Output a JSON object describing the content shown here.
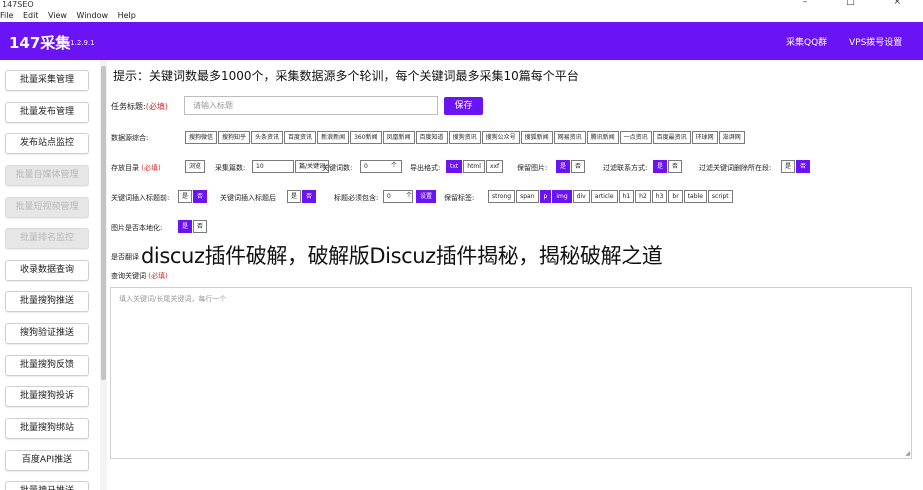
{
  "window": {
    "title": "147SEO",
    "controls": "– □ ×"
  },
  "menu": [
    "File",
    "Edit",
    "View",
    "Window",
    "Help"
  ],
  "header": {
    "app_name": "147采集",
    "version": "v1.2.9.1",
    "links": [
      "采集QQ群",
      "VPS拨号设置"
    ],
    "accent": "#6a13f5"
  },
  "sidebar": {
    "items": [
      {
        "label": "批量采集管理",
        "enabled": true
      },
      {
        "label": "批量发布管理",
        "enabled": true
      },
      {
        "label": "发布站点监控",
        "enabled": true
      },
      {
        "label": "批量自媒体管理",
        "enabled": false
      },
      {
        "label": "批量短视频管理",
        "enabled": false
      },
      {
        "label": "批量排名监控",
        "enabled": false
      },
      {
        "label": "收录数据查询",
        "enabled": true
      },
      {
        "label": "批量搜狗推送",
        "enabled": true
      },
      {
        "label": "搜狗验证推送",
        "enabled": true
      },
      {
        "label": "批量搜狗反馈",
        "enabled": true
      },
      {
        "label": "批量搜狗投诉",
        "enabled": true
      },
      {
        "label": "批量搜狗绑站",
        "enabled": true
      },
      {
        "label": "百度API推送",
        "enabled": true
      },
      {
        "label": "批量神马推送",
        "enabled": true
      }
    ]
  },
  "main": {
    "hint": "提示：关键词数最多1000个，采集数据源多个轮训，每个关键词最多采集10篇每个平台",
    "task": {
      "label": "任务标题:",
      "required": "(必填)",
      "placeholder": "请输入标题",
      "save": "保存"
    },
    "sources": {
      "label": "数据源综合:",
      "items": [
        "搜狗微信",
        "搜狗知乎",
        "头条资讯",
        "百度资讯",
        "新浪新闻",
        "360新闻",
        "凤凰新闻",
        "百度知道",
        "搜狗资讯",
        "搜狗公众号",
        "搜狐新闻",
        "网易资讯",
        "腾讯新闻",
        "一点资讯",
        "百度最资讯",
        "环球网",
        "澎湃网"
      ]
    },
    "row3": {
      "dir_label": "存放目录",
      "dir_required": "(必填)",
      "browse": "浏览",
      "count_label": "采集篇数:",
      "count_value": "10",
      "count_unit": "篇/关键词",
      "kw_label": "关键词数:",
      "kw_value": "0",
      "kw_unit": "个",
      "format_label": "导出格式:",
      "formats": [
        "txt",
        "html",
        "xxf"
      ],
      "format_selected": 0,
      "img_label": "保留图片:",
      "img_options": [
        "是",
        "否"
      ],
      "img_selected": 0,
      "contact_label": "过滤联系方式:",
      "contact_options": [
        "是",
        "否"
      ],
      "contact_selected": 0,
      "keyword_del_label": "过滤关键词删除所在段:",
      "keyword_del_options": [
        "是",
        "否"
      ],
      "keyword_del_selected": 1
    },
    "row4": {
      "before_label": "关键词插入标题前:",
      "before_options": [
        "是",
        "否"
      ],
      "before_selected": 1,
      "after_label": "关键词插入标题后",
      "after_options": [
        "是",
        "否"
      ],
      "after_selected": 1,
      "must_label": "标题必须包含:",
      "must_value": "0",
      "must_unit": "个",
      "must_btn": "设置",
      "tags_label": "保留标签:",
      "tags": [
        "strong",
        "span",
        "p",
        "img",
        "div",
        "article",
        "h1",
        "h2",
        "h3",
        "br",
        "table",
        "script"
      ],
      "tags_selected": [
        2,
        3
      ]
    },
    "row5": {
      "label": "图片是否本地化:",
      "options": [
        "是",
        "否"
      ],
      "selected": 0
    },
    "row6": {
      "label": "是否翻译"
    },
    "query": {
      "label": "查询关键词",
      "required": "(必填)",
      "placeholder": "填入关键词/长尾关键词，每行一个"
    }
  },
  "watermark": {
    "text": "discuz插件破解，破解版Discuz插件揭秘，揭秘破解之道"
  }
}
